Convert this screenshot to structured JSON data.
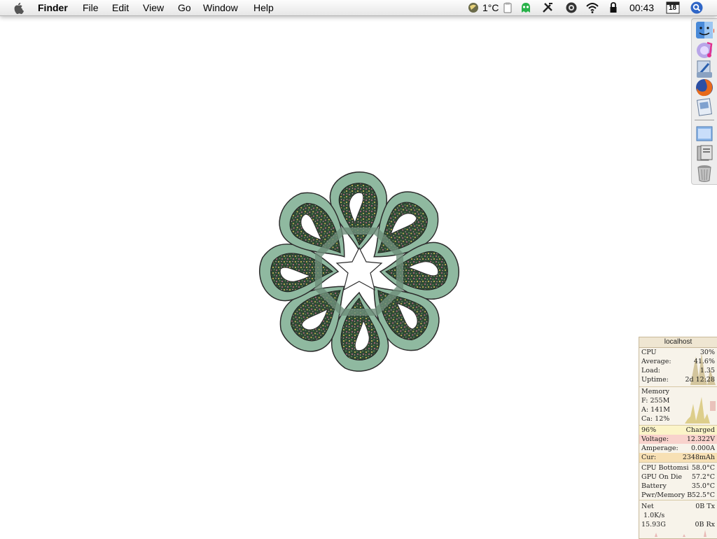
{
  "menubar": {
    "app_name": "Finder",
    "menus": [
      "File",
      "Edit",
      "View",
      "Go",
      "Window",
      "Help"
    ],
    "status": {
      "weather_text": "1°C",
      "clock": "00:43",
      "calendar_day": "18"
    },
    "icons": [
      "apple-logo-icon",
      "weather-globe-icon",
      "clipboard-icon",
      "green-alien-icon",
      "tools-icon",
      "menu-extra-circle-icon",
      "wifi-icon",
      "lock-icon",
      "calendar-icon",
      "spotlight-search-icon"
    ]
  },
  "dock": {
    "icons": [
      "finder-icon",
      "itunes-icon",
      "mail-icon",
      "firefox-icon",
      "preview-icon",
      "desktop-folder-icon",
      "documents-icon",
      "trash-icon"
    ]
  },
  "monitor": {
    "title": "localhost",
    "cpu": {
      "label": "CPU",
      "value": "30%",
      "average_label": "Average:",
      "average_value": "41.6%",
      "load_label": "Load:",
      "load_value": "1.35",
      "uptime_label": "Uptime:",
      "uptime_value": "2d 12:28"
    },
    "memory": {
      "label": "Memory",
      "free": "F: 255M",
      "active": "A: 141M",
      "cache": "Ca: 12%"
    },
    "battery": {
      "percent": "96%",
      "status": "Charged",
      "voltage_label": "Voltage:",
      "voltage_value": "12.322V",
      "amperage_label": "Amperage:",
      "amperage_value": "0.000A",
      "current_label": "Cur:",
      "current_value": "2348mAh"
    },
    "temps": [
      {
        "label": "CPU Bottomsi",
        "value": "58.0°C"
      },
      {
        "label": "GPU On Die",
        "value": "57.2°C"
      },
      {
        "label": "Battery",
        "value": "35.0°C"
      },
      {
        "label": "Pwr/Memory B",
        "value": "52.5°C"
      }
    ],
    "net": {
      "label": "Net",
      "tx": "0B Tx",
      "rate": "1.0K/s",
      "total": "15.93G",
      "rx": "0B Rx"
    }
  },
  "colors": {
    "knot_green": "#8fb9a0",
    "knot_dark": "#2f4a35",
    "monitor_bg": "#f7f3ea",
    "graph_fill": "#c9b98a"
  }
}
